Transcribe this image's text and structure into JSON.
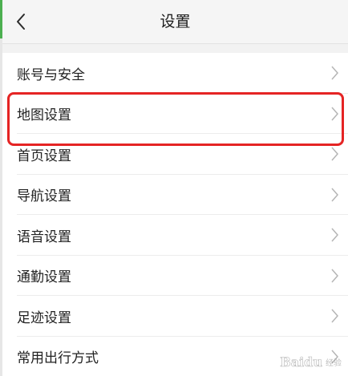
{
  "header": {
    "title": "设置"
  },
  "menu": {
    "items": [
      {
        "label": "账号与安全"
      },
      {
        "label": "地图设置"
      },
      {
        "label": "首页设置"
      },
      {
        "label": "导航设置"
      },
      {
        "label": "语音设置"
      },
      {
        "label": "通勤设置"
      },
      {
        "label": "足迹设置"
      },
      {
        "label": "常用出行方式"
      }
    ]
  },
  "watermark": {
    "brand": "Baidu",
    "sub": "经验"
  },
  "colors": {
    "highlight": "#e52424",
    "accent_stripe": "#4caf50",
    "background": "#f2f2f2"
  }
}
